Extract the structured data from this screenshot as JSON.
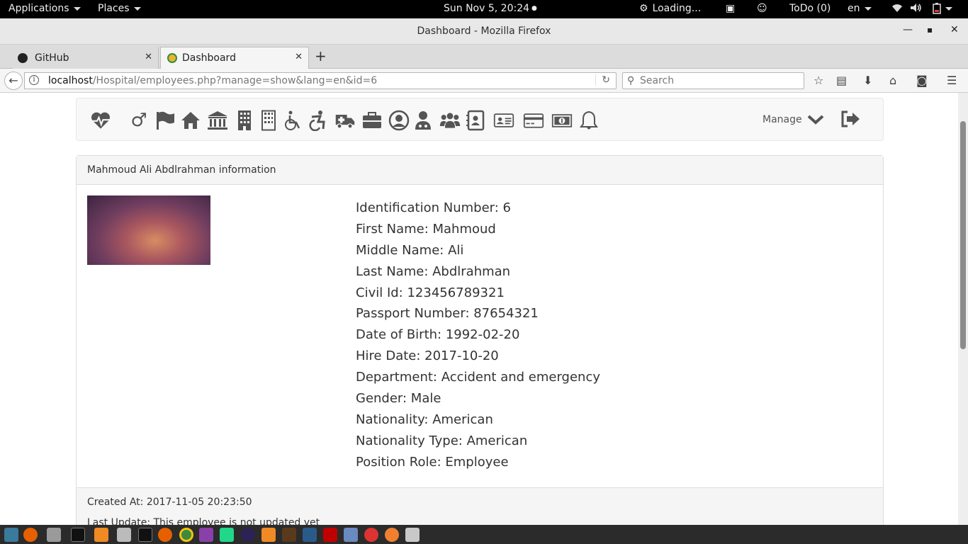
{
  "gnome": {
    "applications": "Applications",
    "places": "Places",
    "clock": "Sun Nov  5, 20:24",
    "loading": "Loading...",
    "todo": "ToDo (0)",
    "lang": "en"
  },
  "window": {
    "title": "Dashboard - Mozilla Firefox"
  },
  "tabs": [
    {
      "label": "GitHub"
    },
    {
      "label": "Dashboard"
    }
  ],
  "urlbar": {
    "host": "localhost",
    "path": "/Hospital/employees.php?manage=show&lang=en&id=6"
  },
  "search": {
    "placeholder": "Search"
  },
  "nav": {
    "icons": [
      "heartbeat-icon",
      "mars-icon",
      "flag-icon",
      "home-icon",
      "university-icon",
      "building-icon",
      "building-outline-icon",
      "wheelchair-icon",
      "wheelchair-alt-icon",
      "ambulance-icon",
      "briefcase-icon",
      "user-circle-icon",
      "user-md-icon",
      "users-icon",
      "address-book-icon",
      "address-card-icon",
      "credit-card-icon",
      "money-icon",
      "bell-icon"
    ],
    "manage": "Manage"
  },
  "panel": {
    "heading": "Mahmoud Ali Abdlrahman information",
    "fields": [
      "Identification Number: 6",
      "First Name: Mahmoud",
      "Middle Name: Ali",
      "Last Name: Abdlrahman",
      "Civil Id: 123456789321",
      "Passport Number: 87654321",
      "Date of Birth: 1992-02-20",
      "Hire Date: 2017-10-20",
      "Department: Accident and emergency",
      "Gender: Male",
      "Nationality: American",
      "Nationality Type: American",
      "Position Role: Employee"
    ],
    "created": "Created At: 2017-11-05 20:23:50",
    "updated": "Last Update: This employee is not updated yet"
  },
  "colors": {
    "accent": "#555555",
    "panel_bg": "#f5f5f5"
  }
}
